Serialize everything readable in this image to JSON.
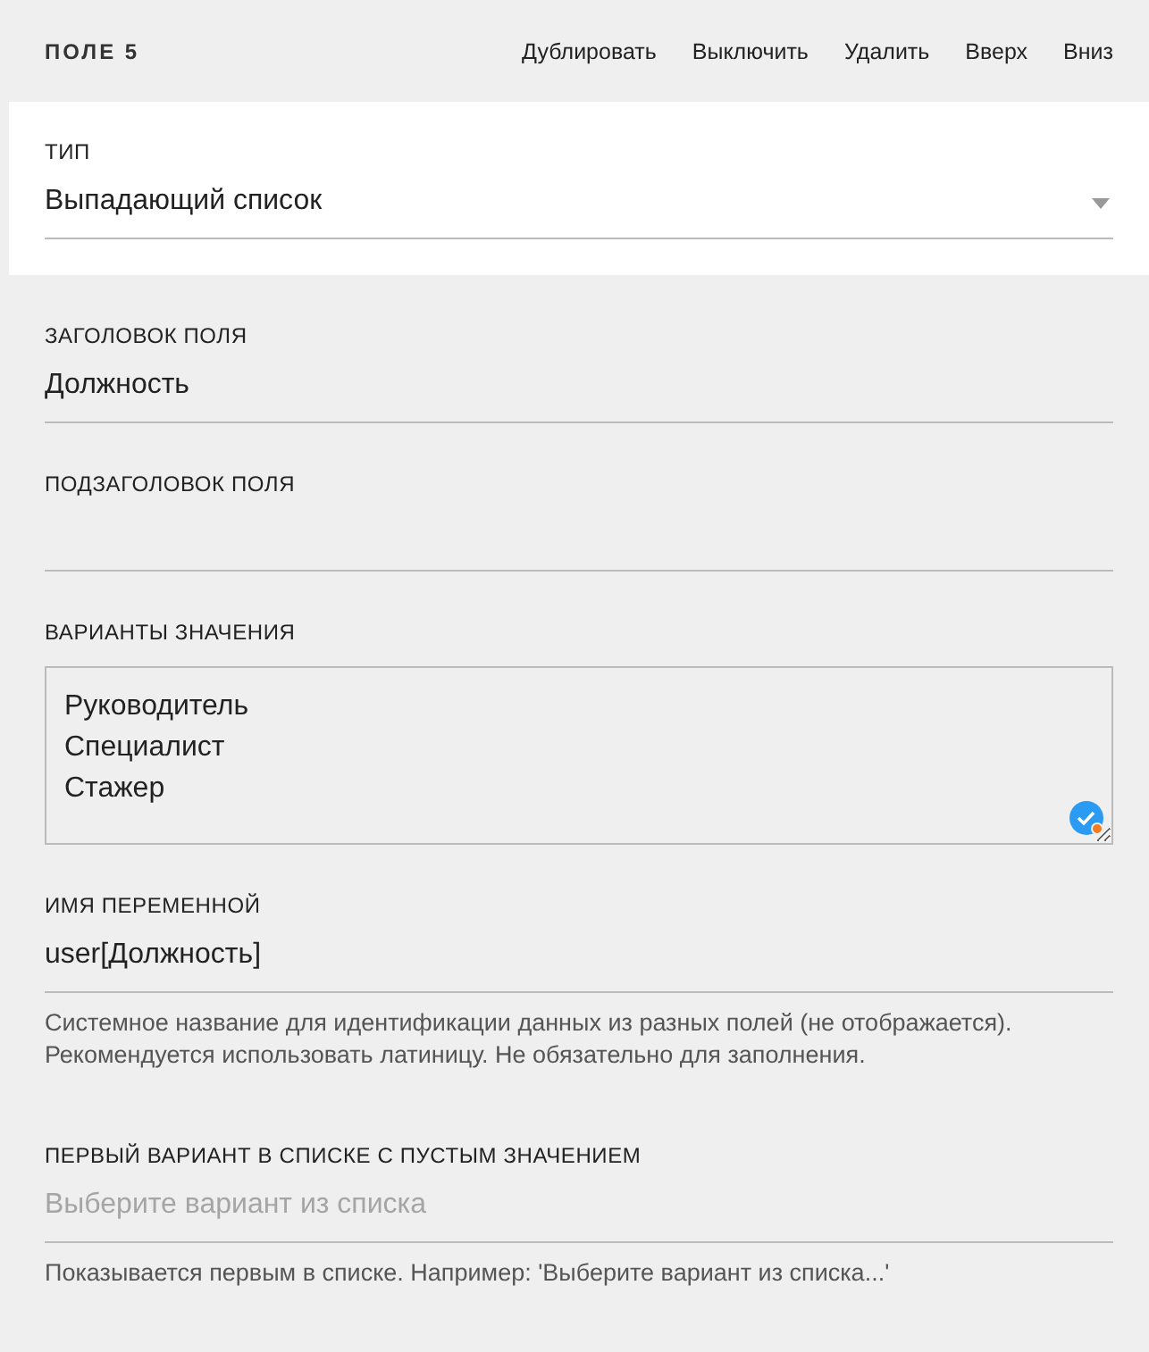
{
  "header": {
    "title": "ПОЛЕ 5",
    "actions": [
      "Дублировать",
      "Выключить",
      "Удалить",
      "Вверх",
      "Вниз"
    ]
  },
  "fields": [
    {
      "kind": "select",
      "label": "ТИП",
      "value": "Выпадающий список"
    },
    {
      "kind": "text",
      "label": "ЗАГОЛОВОК ПОЛЯ",
      "value": "Должность"
    },
    {
      "kind": "text",
      "label": "ПОДЗАГОЛОВОК ПОЛЯ"
    },
    {
      "kind": "textarea",
      "label": "ВАРИАНТЫ ЗНАЧЕНИЯ",
      "lines": [
        "Руководитель",
        "Специалист",
        "Стажер"
      ]
    },
    {
      "kind": "text",
      "label": "ИМЯ ПЕРЕМЕННОЙ",
      "value": "user[Должность]",
      "hint": "Системное название для идентификации данных из разных полей (не отображается). Рекомендуется использовать латиницу. Не обязательно для заполнения."
    },
    {
      "kind": "text",
      "label": "ПЕРВЫЙ ВАРИАНТ В СПИСКЕ С ПУСТЫМ ЗНАЧЕНИЕМ",
      "placeholder": "Выберите вариант из списка",
      "hint": "Показывается первым в списке. Например: 'Выберите вариант из списка...'"
    }
  ]
}
